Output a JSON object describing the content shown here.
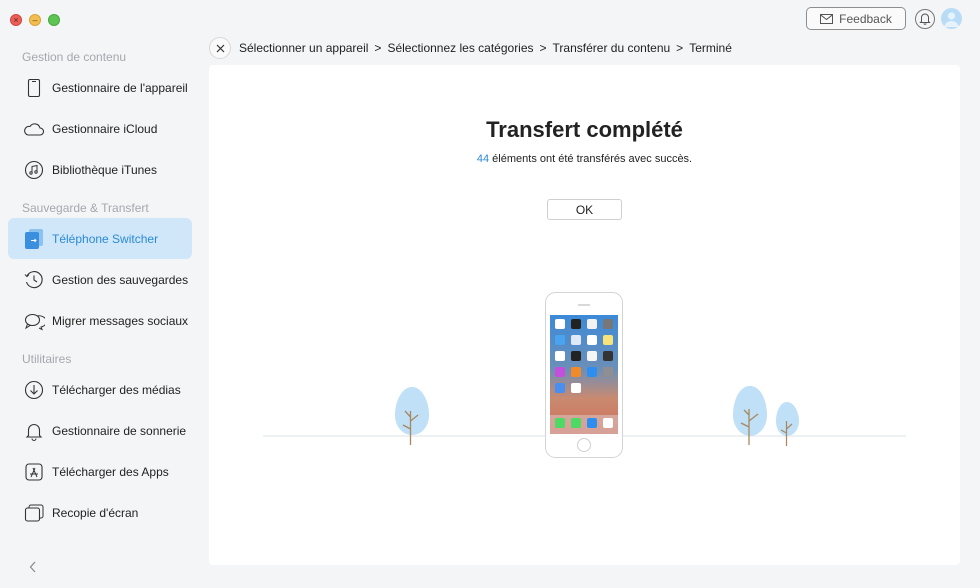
{
  "window": {
    "controls": [
      "close",
      "minimize",
      "maximize"
    ]
  },
  "topbar": {
    "feedback_label": "Feedback",
    "feedback_icon": "mail-icon",
    "notification_icon": "bell-icon",
    "avatar_icon": "user-avatar-icon"
  },
  "sidebar": {
    "sections": [
      {
        "title": "Gestion de contenu",
        "items": [
          {
            "label": "Gestionnaire de l'appareil",
            "icon": "phone-icon"
          },
          {
            "label": "Gestionnaire iCloud",
            "icon": "cloud-icon"
          },
          {
            "label": "Bibliothèque iTunes",
            "icon": "music-icon"
          }
        ]
      },
      {
        "title": "Sauvegarde & Transfert",
        "items": [
          {
            "label": "Téléphone Switcher",
            "icon": "phone-switch-icon",
            "active": true
          },
          {
            "label": "Gestion des sauvegardes",
            "icon": "history-icon"
          },
          {
            "label": "Migrer messages sociaux",
            "icon": "chat-bubbles-icon"
          }
        ]
      },
      {
        "title": "Utilitaires",
        "items": [
          {
            "label": "Télécharger des médias",
            "icon": "download-icon"
          },
          {
            "label": "Gestionnaire de sonnerie",
            "icon": "bell-icon"
          },
          {
            "label": "Télécharger des Apps",
            "icon": "app-store-icon"
          },
          {
            "label": "Recopie d'écran",
            "icon": "screen-mirror-icon"
          }
        ]
      }
    ],
    "collapse_icon": "chevron-left-icon"
  },
  "breadcrumb": {
    "steps": [
      "Sélectionner un appareil",
      "Sélectionnez les catégories",
      "Transférer du contenu",
      "Terminé"
    ],
    "separator": ">"
  },
  "main": {
    "title": "Transfert complété",
    "count": "44",
    "message": " éléments ont été transférés avec succès.",
    "ok_label": "OK"
  },
  "colors": {
    "accent": "#2b8ad6",
    "active_bg": "#d0e7f9",
    "tree": "#bfe0f7",
    "trunk": "#a88760"
  }
}
